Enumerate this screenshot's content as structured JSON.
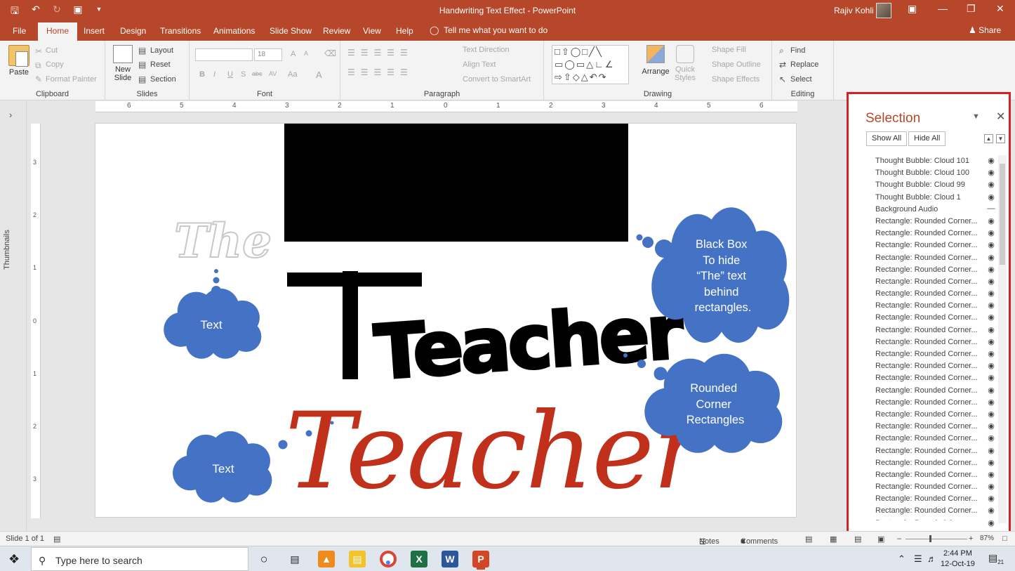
{
  "window": {
    "title": "Handwriting Text Effect  -  PowerPoint",
    "user_name": "Rajiv Kohli",
    "qat_icons": [
      "save-icon",
      "undo-icon",
      "redo-icon",
      "slideshow-icon",
      "customize-icon"
    ]
  },
  "tabs": [
    "File",
    "Home",
    "Insert",
    "Design",
    "Transitions",
    "Animations",
    "Slide Show",
    "Review",
    "View",
    "Help"
  ],
  "active_tab": "Home",
  "tell_me": "Tell me what you want to do",
  "share": "Share",
  "ribbon": {
    "clipboard": {
      "label": "Clipboard",
      "paste": "Paste",
      "cut": "Cut",
      "copy": "Copy",
      "format_painter": "Format Painter"
    },
    "slides": {
      "label": "Slides",
      "new_slide_line1": "New",
      "new_slide_line2": "Slide",
      "layout": "Layout",
      "reset": "Reset",
      "section": "Section"
    },
    "font": {
      "label": "Font",
      "font_name": "",
      "font_size": "18",
      "bold": "B",
      "italic": "I",
      "underline": "U",
      "shadow": "S",
      "strike": "abc",
      "spacing": "AV",
      "case": "Aa",
      "color": "A",
      "grow": "A",
      "shrink": "A"
    },
    "paragraph": {
      "label": "Paragraph",
      "text_direction": "Text Direction",
      "align_text": "Align Text",
      "convert_smartart": "Convert to SmartArt"
    },
    "drawing": {
      "label": "Drawing",
      "arrange": "Arrange",
      "quick_styles_line1": "Quick",
      "quick_styles_line2": "Styles",
      "shape_fill": "Shape Fill",
      "shape_outline": "Shape Outline",
      "shape_effects": "Shape Effects"
    },
    "editing": {
      "label": "Editing",
      "find": "Find",
      "replace": "Replace",
      "select": "Select"
    }
  },
  "thumbnails_label": "Thumbnails",
  "ruler_h": [
    "6",
    "5",
    "4",
    "3",
    "2",
    "1",
    "0",
    "1",
    "2",
    "3",
    "4",
    "5",
    "6"
  ],
  "ruler_v": [
    "3",
    "2",
    "1",
    "0",
    "1",
    "2",
    "3"
  ],
  "slide": {
    "the_text": "The",
    "teacher_black": "Teacher",
    "teacher_red": "Teacher",
    "cloud_text_1": "Text",
    "cloud_text_2": "Text",
    "cloud_blackbox_lines": [
      "Black Box",
      "To hide",
      "“The” text",
      "behind",
      "rectangles."
    ],
    "cloud_rounded_lines": [
      "Rounded",
      "Corner",
      "Rectangles"
    ],
    "colors": {
      "cloud": "#4472c4",
      "red_text": "#c0301a",
      "black_box": "#000000"
    }
  },
  "selection_pane": {
    "title": "Selection",
    "show_all": "Show All",
    "hide_all": "Hide All",
    "items": [
      "Thought Bubble: Cloud 101",
      "Thought Bubble: Cloud 100",
      "Thought Bubble: Cloud 99",
      "Thought Bubble: Cloud 1",
      "Background Audio",
      "Rectangle: Rounded Corner...",
      "Rectangle: Rounded Corner...",
      "Rectangle: Rounded Corner...",
      "Rectangle: Rounded Corner...",
      "Rectangle: Rounded Corner...",
      "Rectangle: Rounded Corner...",
      "Rectangle: Rounded Corner...",
      "Rectangle: Rounded Corner...",
      "Rectangle: Rounded Corner...",
      "Rectangle: Rounded Corner...",
      "Rectangle: Rounded Corner...",
      "Rectangle: Rounded Corner...",
      "Rectangle: Rounded Corner...",
      "Rectangle: Rounded Corner...",
      "Rectangle: Rounded Corner...",
      "Rectangle: Rounded Corner...",
      "Rectangle: Rounded Corner...",
      "Rectangle: Rounded Corner...",
      "Rectangle: Rounded Corner...",
      "Rectangle: Rounded Corner...",
      "Rectangle: Rounded Corner...",
      "Rectangle: Rounded Corner...",
      "Rectangle: Rounded Corner...",
      "Rectangle: Rounded Corner...",
      "Rectangle: Rounded Corner...",
      "Rectangle: Rounded Corner..."
    ]
  },
  "status": {
    "slide_of": "Slide 1 of 1",
    "notes": "Notes",
    "comments": "Comments",
    "zoom": "87%"
  },
  "taskbar": {
    "search_placeholder": "Type here to search",
    "time": "2:44 PM",
    "date": "12-Oct-19",
    "notif_count": "21"
  },
  "accent_color": "#b7472a",
  "highlight_color": "#d42027"
}
